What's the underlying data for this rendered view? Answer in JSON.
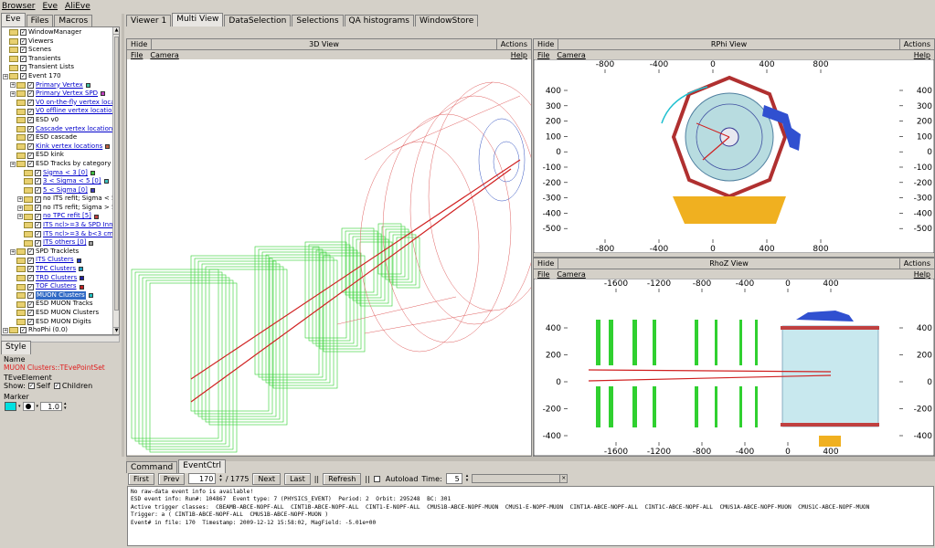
{
  "menu": [
    "Browser",
    "Eve",
    "AliEve"
  ],
  "left_tabs": [
    "Eve",
    "Files",
    "Macros"
  ],
  "tree": [
    {
      "l": "WindowManager",
      "d": 0,
      "e": false
    },
    {
      "l": "Viewers",
      "d": 0,
      "e": false
    },
    {
      "l": "Scenes",
      "d": 0,
      "e": false
    },
    {
      "l": "Transients",
      "d": 0,
      "e": false
    },
    {
      "l": "Transient Lists",
      "d": 0,
      "e": false
    },
    {
      "l": "Event 170",
      "d": 0,
      "e": true
    },
    {
      "l": "Primary Vertex",
      "d": 1,
      "e": true,
      "c": "#40c0a0",
      "link": true
    },
    {
      "l": "Primary Vertex SPD",
      "d": 1,
      "e": true,
      "c": "#c040c0",
      "link": true
    },
    {
      "l": "V0 on-the-fly vertex locations",
      "d": 1,
      "c": "#c04080",
      "link": true
    },
    {
      "l": "V0 offline vertex locations",
      "d": 1,
      "c": "#c08040",
      "link": true
    },
    {
      "l": "ESD v0",
      "d": 1
    },
    {
      "l": "Cascade vertex locations",
      "d": 1,
      "c": "#a040a0",
      "link": true
    },
    {
      "l": "ESD cascade",
      "d": 1
    },
    {
      "l": "Kink vertex locations",
      "d": 1,
      "c": "#c06040",
      "link": true
    },
    {
      "l": "ESD kink",
      "d": 1
    },
    {
      "l": "ESD Tracks by category",
      "d": 1,
      "e": true
    },
    {
      "l": "Sigma < 3 [0]",
      "d": 2,
      "c": "#40c040",
      "link": true
    },
    {
      "l": "3 < Sigma < 5 [0]",
      "d": 2,
      "c": "#40c0c0",
      "link": true
    },
    {
      "l": "5 < Sigma [0]",
      "d": 2,
      "c": "#4040c0",
      "link": true
    },
    {
      "l": "no ITS refit; Sigma < 5 [2]",
      "d": 2,
      "e": true,
      "c": "#c0c040"
    },
    {
      "l": "no ITS refit; Sigma > 5 [10]",
      "d": 2,
      "e": true,
      "c": "#4080c0"
    },
    {
      "l": "no TPC refit [5]",
      "d": 2,
      "e": true,
      "c": "#c04040",
      "link": true
    },
    {
      "l": "ITS ncl>=3 & SPD Inner [0]",
      "d": 2,
      "c": "#40a040",
      "link": true
    },
    {
      "l": "ITS ncl>=3 & b<3 cm [0]",
      "d": 2,
      "c": "#a0a040",
      "link": true
    },
    {
      "l": "ITS others [0]",
      "d": 2,
      "c": "#a0a0a0",
      "link": true
    },
    {
      "l": "SPD Tracklets",
      "d": 1,
      "e": true
    },
    {
      "l": "ITS Clusters",
      "d": 1,
      "c": "#2040c0",
      "link": true
    },
    {
      "l": "TPC Clusters",
      "d": 1,
      "c": "#20a0c0",
      "link": true
    },
    {
      "l": "TRD Clusters",
      "d": 1,
      "c": "#2020a0",
      "link": true
    },
    {
      "l": "TOF Clusters",
      "d": 1,
      "c": "#c02020",
      "link": true
    },
    {
      "l": "MUON Clusters",
      "d": 1,
      "c": "#20c0c0",
      "sel": true
    },
    {
      "l": "ESD MUON Tracks",
      "d": 1
    },
    {
      "l": "ESD MUON Clusters",
      "d": 1
    },
    {
      "l": "ESD MUON Digits",
      "d": 1
    },
    {
      "l": "RhoPhi (0.0)",
      "d": 0,
      "e": true
    }
  ],
  "style": {
    "tab": "Style",
    "name_label": "Name",
    "name_value": "MUON Clusters::TEvePointSet",
    "element_label": "TEveElement",
    "show_label": "Show:",
    "self": "Self",
    "children": "Children",
    "marker_label": "Marker",
    "marker_size": "1.0",
    "marker_color": "#00e0e0"
  },
  "view_tabs": [
    "Viewer 1",
    "Multi View",
    "DataSelection",
    "Selections",
    "QA histograms",
    "WindowStore"
  ],
  "views": {
    "v3d": {
      "hide": "Hide",
      "title": "3D View",
      "actions": "Actions",
      "file": "File",
      "camera": "Camera",
      "help": "Help"
    },
    "rphi": {
      "hide": "Hide",
      "title": "RPhi View",
      "actions": "Actions",
      "file": "File",
      "camera": "Camera",
      "help": "Help",
      "xticks": [
        "-800",
        "-400",
        "0",
        "400",
        "800"
      ],
      "yticks": [
        "400",
        "300",
        "200",
        "100",
        "0",
        "-100",
        "-200",
        "-300",
        "-400",
        "-500"
      ]
    },
    "rhoz": {
      "hide": "Hide",
      "title": "RhoZ View",
      "actions": "Actions",
      "file": "File",
      "camera": "Camera",
      "help": "Help",
      "xticks": [
        "-1600",
        "-1200",
        "-800",
        "-400",
        "0",
        "400"
      ],
      "yticks": [
        "400",
        "200",
        "0",
        "-200",
        "-400"
      ]
    }
  },
  "bottom_tabs": [
    "Command",
    "EventCtrl"
  ],
  "ctrl": {
    "first": "First",
    "prev": "Prev",
    "event": "170",
    "total": "/ 1775",
    "next": "Next",
    "last": "Last",
    "sep": "||",
    "refresh": "Refresh",
    "sep2": "||",
    "autoload": "Autoload",
    "time_label": "Time:",
    "time": "5"
  },
  "log": [
    "No raw-data event info is available!",
    "ESD event info: Run#: 104867  Event type: 7 (PHYSICS_EVENT)  Period: 2  Orbit: 295248  BC: 301",
    "Active trigger classes:  CBEAMB-ABCE-NOPF-ALL  CINT1B-ABCE-NOPF-ALL  CINT1-E-NOPF-ALL  CMUS1B-ABCE-NOPF-MUON  CMUS1-E-NOPF-MUON  CINT1A-ABCE-NOPF-ALL  CINT1C-ABCE-NOPF-ALL  CMUS1A-ABCE-NOPF-MUON  CMUS1C-ABCE-NOPF-MUON",
    "Trigger: a ( CINT1B-ABCE-NOPF-ALL  CMUS1B-ABCE-NOPF-MUON )",
    "Event# in file: 170  Timestamp: 2009-12-12 15:58:02, MagField: -5.01e+00"
  ]
}
